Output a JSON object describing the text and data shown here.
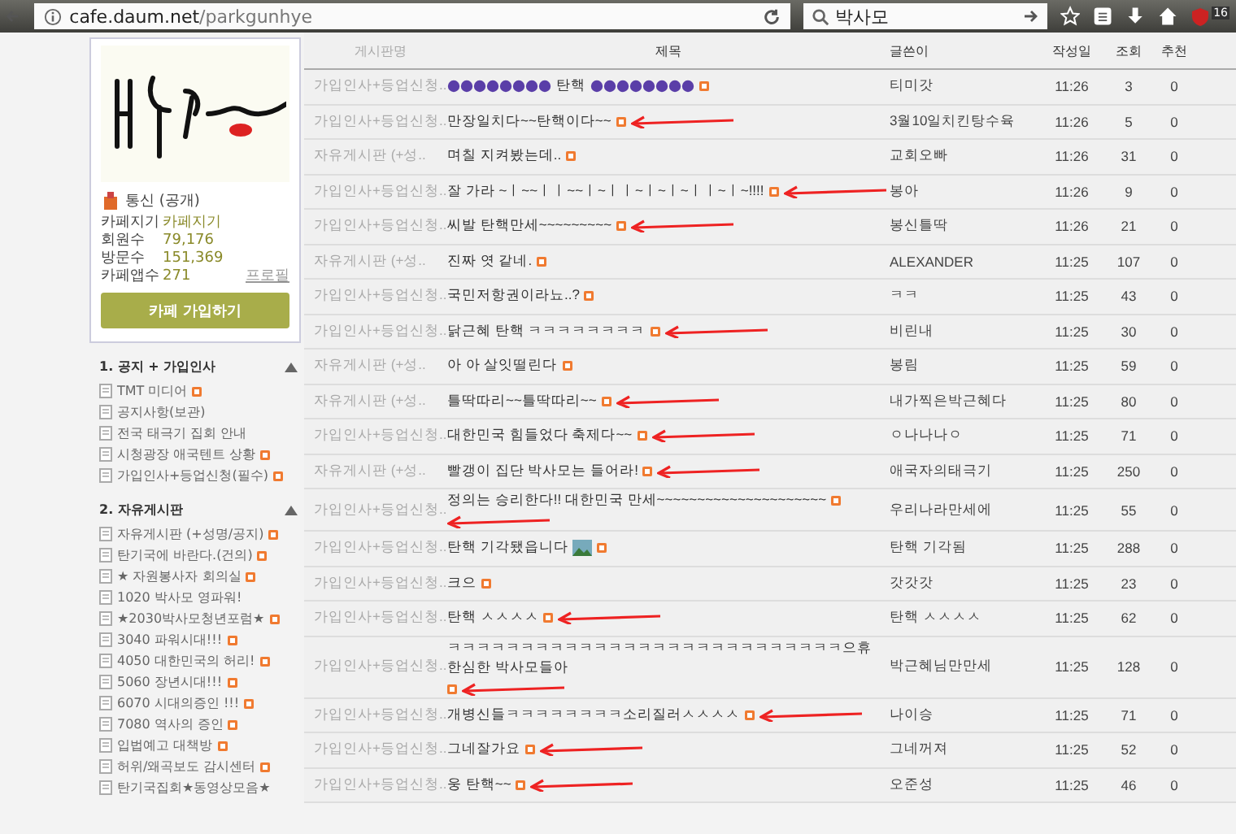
{
  "browser": {
    "url_host": "cafe.daum.net",
    "url_path": "/parkgunhye",
    "search_value": "박사모",
    "badge": "16"
  },
  "sidebar": {
    "cafe_status": "통신 (공개)",
    "stats": [
      {
        "label": "카페지기",
        "value": "카페지기"
      },
      {
        "label": "회원수",
        "value": "79,176"
      },
      {
        "label": "방문수",
        "value": "151,369"
      },
      {
        "label": "카페앱수",
        "value": "271"
      }
    ],
    "profile_link": "프로필",
    "join_button": "카페 가입하기",
    "sections": [
      {
        "title": "1. 공지 + 가입인사",
        "expanded": true,
        "items": [
          {
            "label": "TMT 미디어",
            "new": true
          },
          {
            "label": "공지사항(보관)",
            "new": false
          },
          {
            "label": "전국 태극기 집회 안내",
            "new": false
          },
          {
            "label": "시청광장 애국텐트 상황",
            "new": true
          },
          {
            "label": "가입인사+등업신청(필수)",
            "new": true
          }
        ]
      },
      {
        "title": "2. 자유게시판",
        "expanded": true,
        "items": [
          {
            "label": "자유게시판 (+성명/공지)",
            "new": true
          },
          {
            "label": "탄기국에 바란다.(건의)",
            "new": true
          },
          {
            "label": "★ 자원봉사자 회의실",
            "new": true
          },
          {
            "label": "1020 박사모 영파워!",
            "new": false
          },
          {
            "label": "★2030박사모청년포럼★",
            "new": true
          },
          {
            "label": "3040 파워시대!!!",
            "new": true
          },
          {
            "label": "4050 대한민국의 허리!",
            "new": true
          },
          {
            "label": "5060 장년시대!!!",
            "new": true
          },
          {
            "label": "6070 시대의증인 !!!",
            "new": true
          },
          {
            "label": "7080 역사의 증인",
            "new": true
          },
          {
            "label": "입법예고 대책방",
            "new": true
          },
          {
            "label": "허위/왜곡보도 감시센터",
            "new": true
          },
          {
            "label": "탄기국집회★동영상모음★",
            "new": false
          }
        ]
      }
    ]
  },
  "table": {
    "columns": [
      "게시판명",
      "제목",
      "글쓴이",
      "작성일",
      "조회",
      "추천"
    ],
    "rows": [
      {
        "board": "가입인사+등업신청..",
        "kind": "decorated",
        "title": "탄핵",
        "image": false,
        "arrow": false,
        "author": "티미갓",
        "date": "11:26",
        "views": "3",
        "likes": "0"
      },
      {
        "board": "가입인사+등업신청..",
        "kind": "plain",
        "title": "만장일치다~~탄핵이다~~",
        "image": false,
        "arrow": true,
        "author": "3월10일치킨탕수육",
        "date": "11:26",
        "views": "5",
        "likes": "0"
      },
      {
        "board": "자유게시판 (+성..",
        "kind": "plain",
        "title": "며칠 지켜봤는데..",
        "image": false,
        "arrow": false,
        "author": "교회오빠",
        "date": "11:26",
        "views": "31",
        "likes": "0"
      },
      {
        "board": "가입인사+등업신청..",
        "kind": "plain",
        "title": "잘 가라 ~ㅣ~~ㅣㅣ~~ㅣ~ㅣㅣ~ㅣ~ㅣ~ㅣㅣ~ㅣ~!!!!",
        "image": false,
        "arrow": true,
        "author": "봉아",
        "date": "11:26",
        "views": "9",
        "likes": "0"
      },
      {
        "board": "가입인사+등업신청..",
        "kind": "plain",
        "title": "씨발 탄핵만세~~~~~~~~~",
        "image": false,
        "arrow": true,
        "author": "봉신틀딱",
        "date": "11:26",
        "views": "21",
        "likes": "0"
      },
      {
        "board": "자유게시판 (+성..",
        "kind": "plain",
        "title": "진짜 엿 같네.",
        "image": false,
        "arrow": false,
        "author": "ALEXANDER",
        "date": "11:25",
        "views": "107",
        "likes": "0"
      },
      {
        "board": "가입인사+등업신청..",
        "kind": "plain",
        "title": "국민저항권이라뇨..?",
        "image": false,
        "arrow": false,
        "author": "ㅋㅋ",
        "date": "11:25",
        "views": "43",
        "likes": "0"
      },
      {
        "board": "가입인사+등업신청..",
        "kind": "plain",
        "title": "닭근혜 탄핵 ㅋㅋㅋㅋㅋㅋㅋㅋ",
        "image": false,
        "arrow": true,
        "author": "비린내",
        "date": "11:25",
        "views": "30",
        "likes": "0"
      },
      {
        "board": "자유게시판 (+성..",
        "kind": "plain",
        "title": "아 아 살잇떨린다",
        "image": false,
        "arrow": false,
        "author": "봉림",
        "date": "11:25",
        "views": "59",
        "likes": "0"
      },
      {
        "board": "자유게시판 (+성..",
        "kind": "plain",
        "title": "틀딱따리~~틀딱따리~~",
        "image": false,
        "arrow": true,
        "author": "내가찍은박근혜다",
        "date": "11:25",
        "views": "80",
        "likes": "0"
      },
      {
        "board": "가입인사+등업신청..",
        "kind": "plain",
        "title": "대한민국 힘들었다 축제다~~",
        "image": false,
        "arrow": true,
        "author": "ㅇ나나나ㅇ",
        "date": "11:25",
        "views": "71",
        "likes": "0"
      },
      {
        "board": "자유게시판 (+성..",
        "kind": "plain",
        "title": "빨갱이 집단 박사모는 들어라!",
        "image": false,
        "arrow": true,
        "author": "애국자의태극기",
        "date": "11:25",
        "views": "250",
        "likes": "0"
      },
      {
        "board": "가입인사+등업신청..",
        "kind": "plain",
        "title": "정의는 승리한다!! 대한민국 만세~~~~~~~~~~~~~~~~~~~~~",
        "image": false,
        "arrow": true,
        "author": "우리나라만세에",
        "date": "11:25",
        "views": "55",
        "likes": "0"
      },
      {
        "board": "가입인사+등업신청..",
        "kind": "plain",
        "title": "탄핵 기각됐읍니다",
        "image": true,
        "arrow": false,
        "author": "탄핵 기각됨",
        "date": "11:25",
        "views": "288",
        "likes": "0"
      },
      {
        "board": "가입인사+등업신청..",
        "kind": "plain",
        "title": "크으",
        "image": false,
        "arrow": false,
        "author": "갓갓갓",
        "date": "11:25",
        "views": "23",
        "likes": "0"
      },
      {
        "board": "가입인사+등업신청..",
        "kind": "plain",
        "title": "탄핵 ㅅㅅㅅㅅ",
        "image": false,
        "arrow": true,
        "author": "탄핵 ㅅㅅㅅㅅ",
        "date": "11:25",
        "views": "62",
        "likes": "0"
      },
      {
        "board": "가입인사+등업신청..",
        "kind": "plain",
        "title": "ㅋㅋㅋㅋㅋㅋㅋㅋㅋㅋㅋㅋㅋㅋㅋㅋㅋㅋㅋㅋㅋㅋㅋㅋㅋㅋㅋ으휴 한심한 박사모들아",
        "image": false,
        "arrow": true,
        "author": "박근혜님만만세",
        "date": "11:25",
        "views": "128",
        "likes": "0"
      },
      {
        "board": "가입인사+등업신청..",
        "kind": "plain",
        "title": "개병신들ㅋㅋㅋㅋㅋㅋㅋㅋ소리질러ㅅㅅㅅㅅ",
        "image": false,
        "arrow": true,
        "author": "나이승",
        "date": "11:25",
        "views": "71",
        "likes": "0"
      },
      {
        "board": "가입인사+등업신청..",
        "kind": "plain",
        "title": "그네잘가요",
        "image": false,
        "arrow": true,
        "author": "그네꺼져",
        "date": "11:25",
        "views": "52",
        "likes": "0"
      },
      {
        "board": "가입인사+등업신청..",
        "kind": "plain",
        "title": "웅 탄핵~~",
        "image": false,
        "arrow": true,
        "author": "오준성",
        "date": "11:25",
        "views": "46",
        "likes": "0"
      }
    ]
  }
}
